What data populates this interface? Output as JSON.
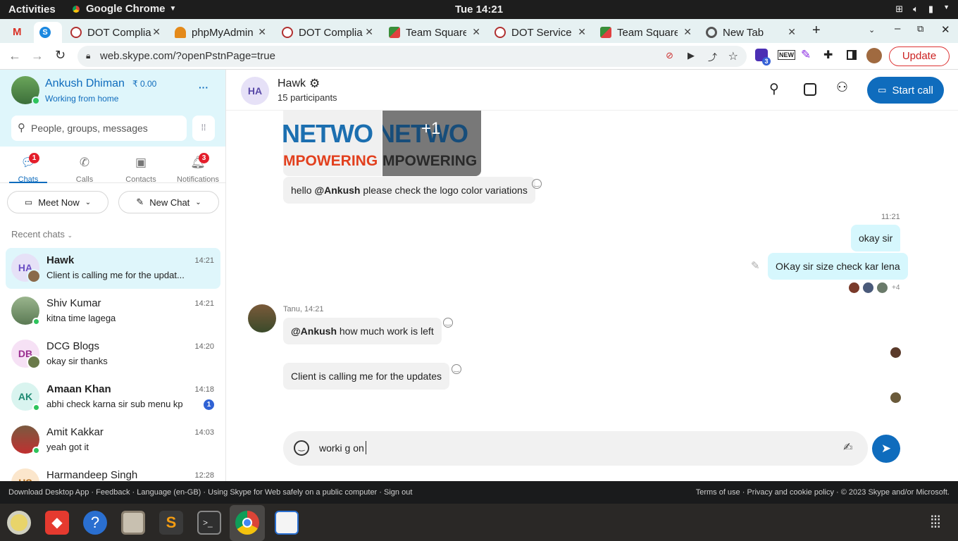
{
  "system": {
    "activities": "Activities",
    "app": "Google Chrome",
    "clock": "Tue 14:21"
  },
  "tabs": [
    {
      "title": "",
      "fav": "gmail-icon",
      "color": "#d93025"
    },
    {
      "title": "",
      "fav": "skype-icon",
      "color": "#1b88e0"
    },
    {
      "title": "DOT Complia",
      "fav": "shield-icon",
      "color": "#b03030"
    },
    {
      "title": "phpMyAdmin",
      "fav": "phpmyadmin-icon",
      "color": "#e48a1a"
    },
    {
      "title": "DOT Complia",
      "fav": "shield-icon",
      "color": "#b03030"
    },
    {
      "title": "Team Square",
      "fav": "teamsquare-icon",
      "color": "#3a8f3a"
    },
    {
      "title": "DOT Service",
      "fav": "shield-icon",
      "color": "#b03030"
    },
    {
      "title": "Team Square",
      "fav": "teamsquare-icon",
      "color": "#3a8f3a"
    },
    {
      "title": "New Tab",
      "fav": "chrome-icon",
      "color": "#555"
    }
  ],
  "url": "web.skype.com/?openPstnPage=true",
  "update_label": "Update",
  "ext_badge": "3",
  "profile": {
    "name": "Ankush Dhiman",
    "credit": "₹ 0.00",
    "status": "Working from home",
    "more": "···"
  },
  "search_placeholder": "People, groups, messages",
  "nav": [
    {
      "label": "Chats",
      "badge": "1"
    },
    {
      "label": "Calls",
      "badge": ""
    },
    {
      "label": "Contacts",
      "badge": ""
    },
    {
      "label": "Notifications",
      "badge": "3"
    }
  ],
  "meet_now": "Meet Now",
  "new_chat": "New Chat",
  "recent_header": "Recent chats",
  "chats": [
    {
      "initials": "HA",
      "name": "Hawk",
      "preview": "Client is calling me for the updat...",
      "time": "14:21",
      "bold": true,
      "unread": ""
    },
    {
      "initials": "",
      "name": "Shiv Kumar",
      "preview": "kitna time lagega",
      "time": "14:21",
      "bold": false,
      "unread": ""
    },
    {
      "initials": "DB",
      "name": "DCG Blogs",
      "preview": "okay sir thanks",
      "time": "14:20",
      "bold": false,
      "unread": ""
    },
    {
      "initials": "AK",
      "name": "Amaan Khan",
      "preview": "abhi check karna sir sub menu kp",
      "time": "14:18",
      "bold": true,
      "unread": "1"
    },
    {
      "initials": "",
      "name": "Amit Kakkar",
      "preview": "yeah got it",
      "time": "14:03",
      "bold": false,
      "unread": ""
    },
    {
      "initials": "HS",
      "name": "Harmandeep Singh",
      "preview": "",
      "time": "12:28",
      "bold": false,
      "unread": ""
    }
  ],
  "conversation": {
    "initials": "HA",
    "title": "Hawk",
    "participants": "15 participants",
    "start_call": "Start call",
    "image_text_1": "NETWO",
    "image_sub_1": "MPOWERING",
    "image_text_2": "NETWO",
    "image_sub_2": "MPOWERING",
    "image_more": "+1",
    "msg1_prefix": "hello ",
    "msg1_mention": "@Ankush",
    "msg1_rest": " please check the logo color variations",
    "my_time": "11:21",
    "my_msg1": "okay sir",
    "my_msg2": "OKay sir size check kar lena",
    "seen_more": "+4",
    "sender_meta": "Tanu, 14:21",
    "msg2_mention": "@Ankush",
    "msg2_rest": " how much work is left",
    "msg3": "Client is calling me for the updates",
    "draft": "worki g on"
  },
  "footer": {
    "left": [
      "Download Desktop App",
      "Feedback",
      "Language (en-GB)",
      "Using Skype for Web safely on a public computer",
      "Sign out"
    ],
    "right": [
      "Terms of use",
      "Privacy and cookie policy",
      "© 2023 Skype and/or Microsoft."
    ]
  },
  "colors": {
    "accent": "#0f6cbd",
    "unread": "#e41e2b",
    "online": "#2ec45c",
    "bubble_me": "#d6f7fd"
  }
}
